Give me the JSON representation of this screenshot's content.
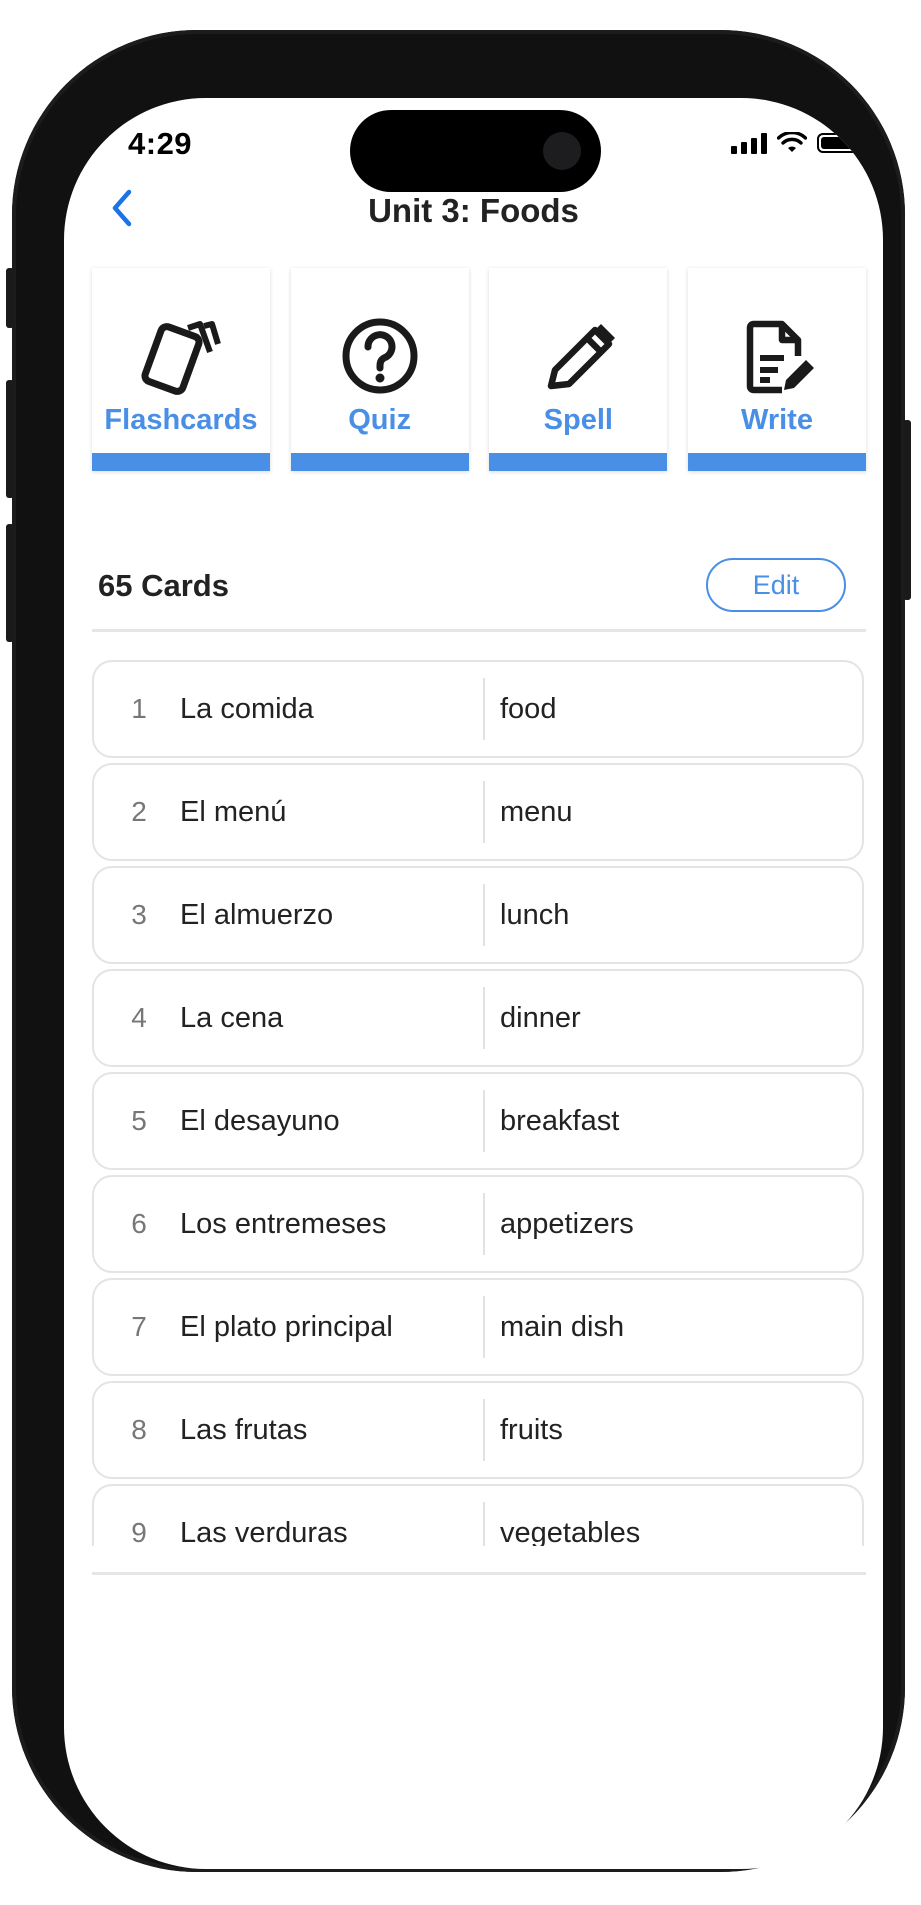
{
  "status_bar": {
    "time": "4:29"
  },
  "header": {
    "title": "Unit 3: Foods"
  },
  "modes": [
    {
      "label": "Flashcards",
      "icon": "flashcards-icon"
    },
    {
      "label": "Quiz",
      "icon": "question-circle-icon"
    },
    {
      "label": "Spell",
      "icon": "pencil-icon"
    },
    {
      "label": "Write",
      "icon": "document-edit-icon"
    }
  ],
  "set": {
    "count_label": "65 Cards",
    "edit_label": "Edit"
  },
  "cards": [
    {
      "num": "1",
      "term": "La comida",
      "definition": "food"
    },
    {
      "num": "2",
      "term": "El menú",
      "definition": "menu"
    },
    {
      "num": "3",
      "term": "El almuerzo",
      "definition": "lunch"
    },
    {
      "num": "4",
      "term": "La cena",
      "definition": "dinner"
    },
    {
      "num": "5",
      "term": "El desayuno",
      "definition": "breakfast"
    },
    {
      "num": "6",
      "term": "Los entremeses",
      "definition": "appetizers"
    },
    {
      "num": "7",
      "term": "El plato principal",
      "definition": "main dish"
    },
    {
      "num": "8",
      "term": "Las frutas",
      "definition": "fruits"
    },
    {
      "num": "9",
      "term": "Las verduras",
      "definition": "vegetables"
    }
  ],
  "colors": {
    "accent": "#4a8fe6",
    "back_arrow": "#1a73e8"
  }
}
